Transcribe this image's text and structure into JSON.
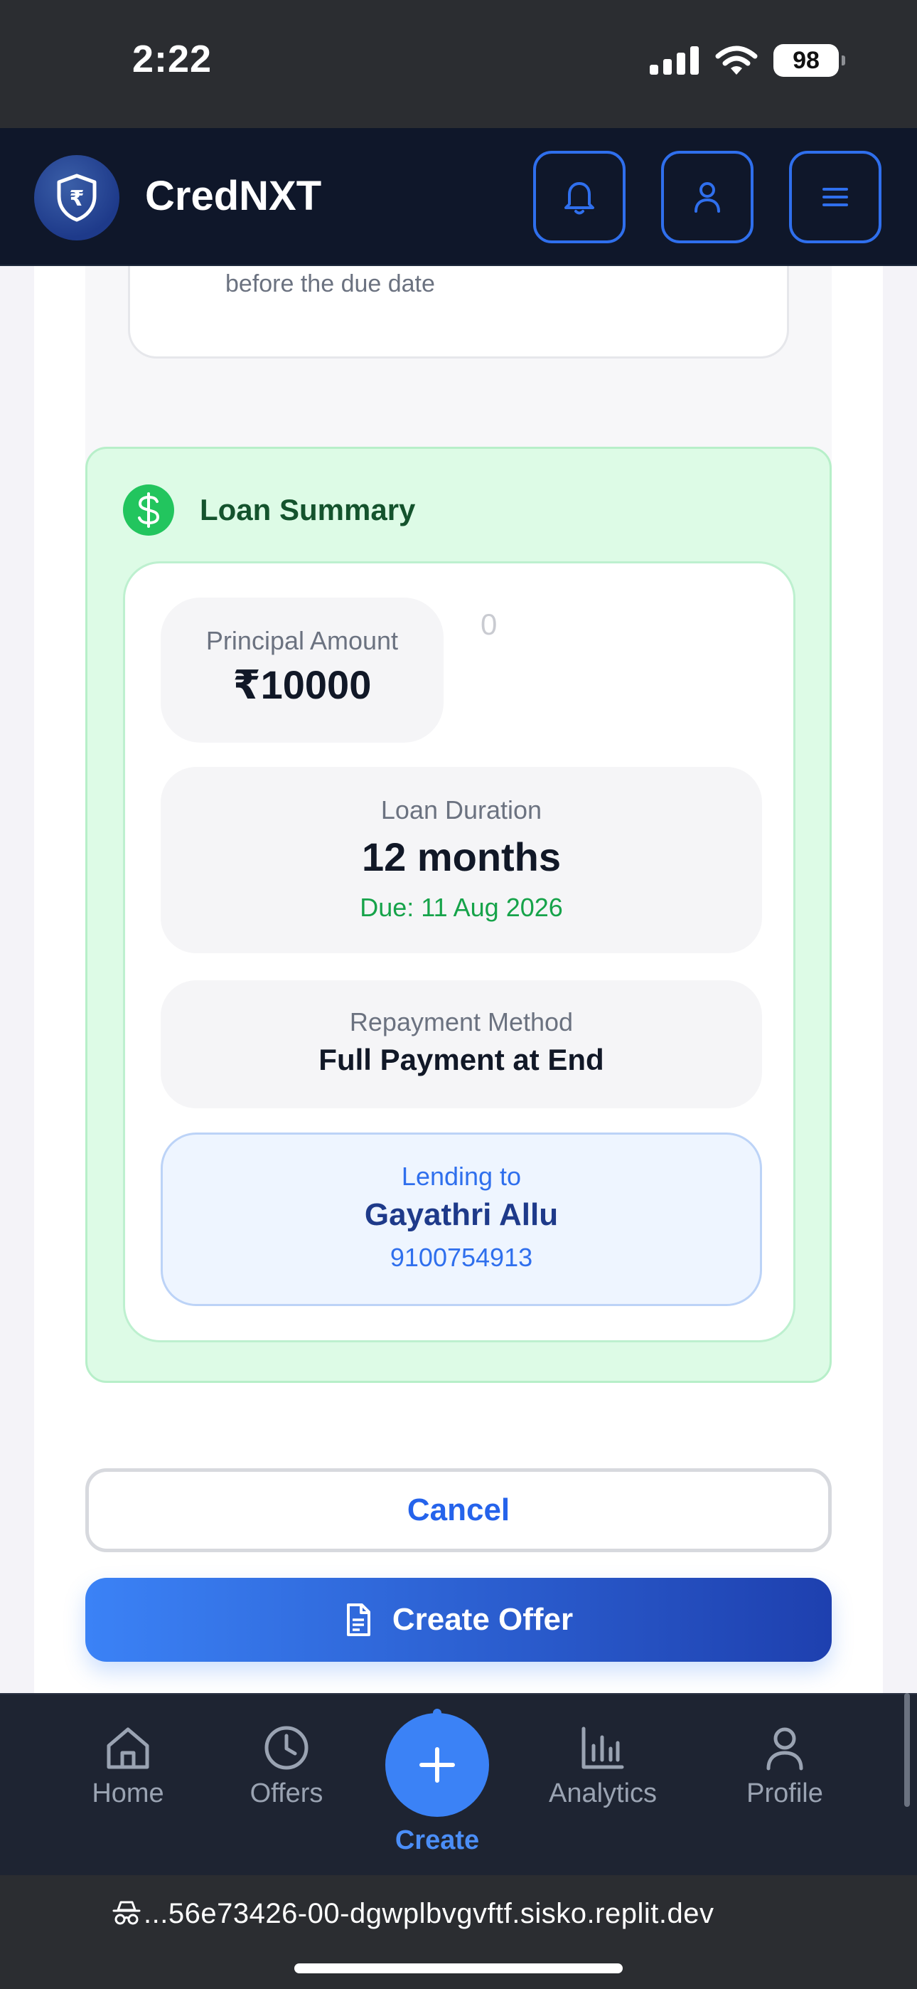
{
  "status_bar": {
    "time": "2:22",
    "battery": "98"
  },
  "header": {
    "brand": "CredNXT",
    "logo_symbol": "₹",
    "buttons": [
      "bell-icon",
      "user-icon",
      "menu-icon"
    ]
  },
  "repayment_option": {
    "description": "Allow the borrower to make partial repayments before the due date"
  },
  "summary": {
    "title": "Loan Summary",
    "principal_label": "Principal Amount",
    "principal_value": "₹10000",
    "stray_value": "0",
    "duration_label": "Loan Duration",
    "duration_value": "12 months",
    "due": "Due: 11 Aug 2026",
    "method_label": "Repayment Method",
    "method_value": "Full Payment at End",
    "lending_label": "Lending to",
    "borrower_name": "Gayathri Allu",
    "borrower_phone": "9100754913"
  },
  "actions": {
    "cancel": "Cancel",
    "create": "Create Offer"
  },
  "nav": {
    "home": "Home",
    "offers": "Offers",
    "create": "Create",
    "analytics": "Analytics",
    "profile": "Profile"
  },
  "url": "...56e73426-00-dgwplbvgvftf.sisko.replit.dev",
  "colors": {
    "accent": "#2f6fed",
    "success": "#16a34a",
    "header_bg": "#0f172a",
    "summary_bg": "#ddfbe6"
  }
}
